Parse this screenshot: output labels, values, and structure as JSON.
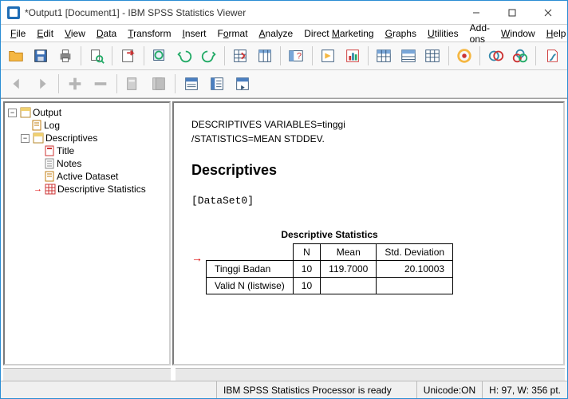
{
  "window": {
    "title": "*Output1 [Document1] - IBM SPSS Statistics Viewer"
  },
  "menu": {
    "file": "File",
    "edit": "Edit",
    "view": "View",
    "data": "Data",
    "transform": "Transform",
    "insert": "Insert",
    "format": "Format",
    "analyze": "Analyze",
    "directmarketing": "Direct Marketing",
    "graphs": "Graphs",
    "utilities": "Utilities",
    "addons": "Add-ons",
    "window": "Window",
    "help": "Help"
  },
  "tree": {
    "root": "Output",
    "log": "Log",
    "descriptives": "Descriptives",
    "children": {
      "title": "Title",
      "notes": "Notes",
      "active_dataset": "Active Dataset",
      "descriptive_statistics": "Descriptive Statistics"
    }
  },
  "content": {
    "syntax_line1": "DESCRIPTIVES VARIABLES=tinggi",
    "syntax_line2": "  /STATISTICS=MEAN STDDEV.",
    "section_title": "Descriptives",
    "dataset_label": "[DataSet0]"
  },
  "chart_data": {
    "type": "table",
    "title": "Descriptive Statistics",
    "columns": [
      "",
      "N",
      "Mean",
      "Std. Deviation"
    ],
    "rows": [
      {
        "label": "Tinggi Badan",
        "n": "10",
        "mean": "119.7000",
        "std": "20.10003"
      },
      {
        "label": "Valid N (listwise)",
        "n": "10",
        "mean": "",
        "std": ""
      }
    ]
  },
  "status": {
    "ready": "IBM SPSS Statistics Processor is ready",
    "unicode": "Unicode:ON",
    "dims": "H: 97, W: 356 pt."
  }
}
